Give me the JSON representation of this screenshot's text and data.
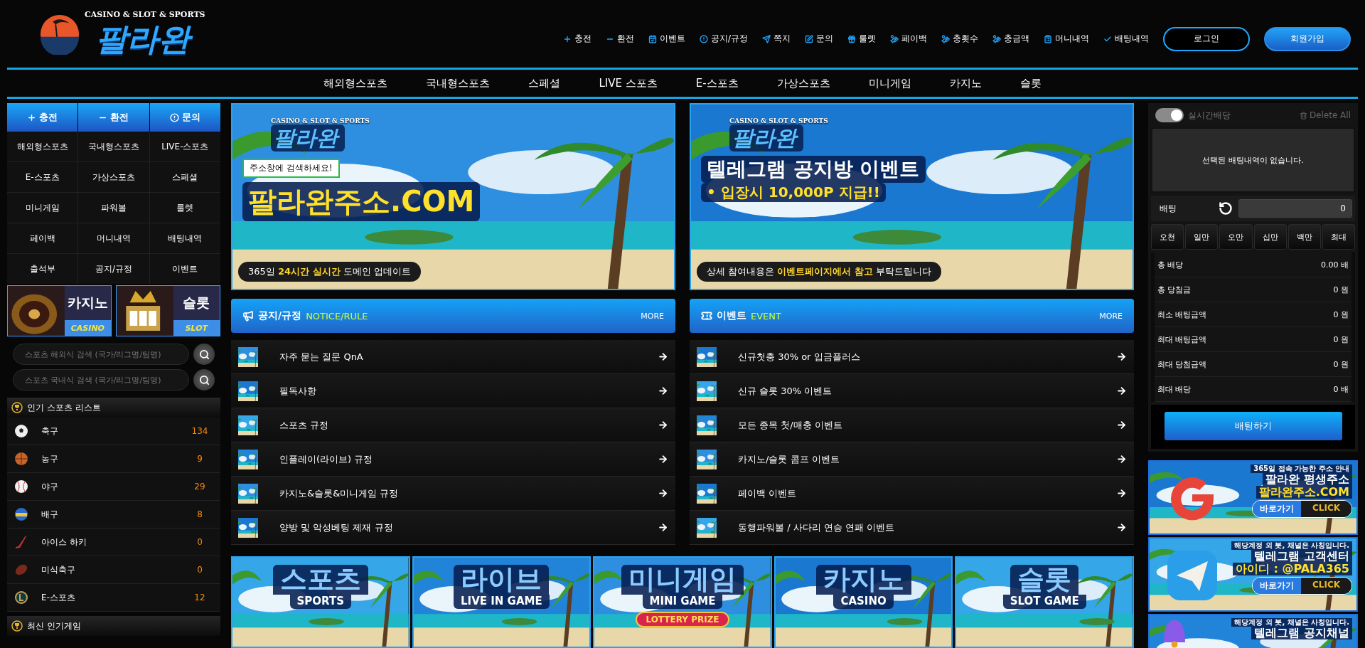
{
  "header": {
    "logo": {
      "tagline": "CASINO & SLOT & SPORTS",
      "name": "팔라완"
    },
    "menu": [
      {
        "label": "충전",
        "kind": "plus"
      },
      {
        "label": "환전",
        "kind": "minus"
      },
      {
        "label": "이벤트",
        "kind": "calendar"
      },
      {
        "label": "공지/규정",
        "kind": "alert"
      },
      {
        "label": "쪽지",
        "kind": "send"
      },
      {
        "label": "문의",
        "kind": "edit"
      },
      {
        "label": "룰렛",
        "kind": "gift"
      },
      {
        "label": "페이백",
        "kind": "hand"
      },
      {
        "label": "충횟수",
        "kind": "hand"
      },
      {
        "label": "충금액",
        "kind": "hand"
      },
      {
        "label": "머니내역",
        "kind": "clipboard"
      },
      {
        "label": "배팅내역",
        "kind": "check"
      }
    ],
    "buttons": [
      {
        "label": "로그인",
        "kind": "outline"
      },
      {
        "label": "회원가입",
        "kind": "filled"
      }
    ]
  },
  "nav": [
    "해외형스포츠",
    "국내형스포츠",
    "스페셜",
    "LIVE 스포츠",
    "E-스포츠",
    "가상스포츠",
    "미니게임",
    "카지노",
    "슬롯"
  ],
  "sidebar": {
    "actions": [
      {
        "label": "충전",
        "kind": "plus"
      },
      {
        "label": "환전",
        "kind": "minus"
      },
      {
        "label": "문의",
        "kind": "alert"
      }
    ],
    "links": [
      "해외형스포츠",
      "국내형스포츠",
      "LIVE-스포츠",
      "E-스포츠",
      "가상스포츠",
      "스페셜",
      "미니게임",
      "파워볼",
      "룰렛",
      "페이백",
      "머니내역",
      "배팅내역",
      "출석부",
      "공지/규정",
      "이벤트"
    ],
    "game_cards": [
      {
        "title": "카지노",
        "subtitle": "CASINO",
        "kind": "casino"
      },
      {
        "title": "슬롯",
        "subtitle": "SLOT",
        "kind": "slot"
      }
    ],
    "searches": [
      {
        "placeholder": "스포츠 해외식 검색 (국가/리그명/팀명)"
      },
      {
        "placeholder": "스포츠 국내식 검색 (국가/리그명/팀명)"
      }
    ],
    "popular": {
      "title": "인기 스포츠 리스트",
      "items": [
        {
          "name": "축구",
          "count": "134",
          "kind": "soccer"
        },
        {
          "name": "농구",
          "count": "9",
          "kind": "basketball"
        },
        {
          "name": "야구",
          "count": "29",
          "kind": "baseball"
        },
        {
          "name": "배구",
          "count": "8",
          "kind": "volleyball"
        },
        {
          "name": "아이스 하키",
          "count": "0",
          "kind": "hockey"
        },
        {
          "name": "미식축구",
          "count": "0",
          "kind": "football"
        },
        {
          "name": "E-스포츠",
          "count": "12",
          "kind": "esports"
        }
      ]
    },
    "next_title": "최신 인기게임"
  },
  "banners": [
    {
      "tagline": "CASINO & SLOT & SPORTS",
      "logo": "팔라완",
      "lines": [
        "주소창에 검색하세요!",
        "팔라완주소.COM",
        "365일 **24시간 실시간** 도메인 업데이트"
      ],
      "kind": "address"
    },
    {
      "tagline": "CASINO & SLOT & SPORTS",
      "logo": "팔라완",
      "lines": [
        "텔레그램 공지방 이벤트",
        "• 입장시 10,000P 지급!!",
        "상세 참여내용은 **이벤트페이지에서 참고** 부탁드립니다"
      ],
      "kind": "telegram"
    }
  ],
  "boards": [
    {
      "title": "공지/규정",
      "subtitle": "NOTICE/RULE",
      "more": "MORE",
      "kind": "megaphone",
      "items": [
        "자주 묻는 질문 QnA",
        "필독사항",
        "스포츠 규정",
        "인플레이(라이브) 규정",
        "카지노&슬롯&미니게임 규정",
        "양방 및 악성베팅 제재 규정"
      ]
    },
    {
      "title": "이벤트",
      "subtitle": "EVENT",
      "more": "MORE",
      "kind": "ticket",
      "items": [
        "신규첫충 30% or 입금플러스",
        "신규 슬롯 30% 이벤트",
        "모든 종목 첫/매충 이벤트",
        "카지노/슬롯 콤프 이벤트",
        "페이백 이벤트",
        "동행파워볼 / 사다리 연승 연패 이벤트"
      ]
    }
  ],
  "tiles": [
    {
      "title": "스포츠",
      "subtitle": "SPORTS"
    },
    {
      "title": "라이브",
      "subtitle": "LIVE IN GAME"
    },
    {
      "title": "미니게임",
      "subtitle": "MINI GAME",
      "badge": "LOTTERY PRIZE"
    },
    {
      "title": "카지노",
      "subtitle": "CASINO"
    },
    {
      "title": "슬롯",
      "subtitle": "SLOT GAME"
    }
  ],
  "betslip": {
    "live_odds": {
      "label": "실시간배당",
      "on": true
    },
    "delete_all": "Delete All",
    "empty_message": "선택된 배팅내역이 없습니다.",
    "bet_label": "배팅",
    "amount": "0",
    "chips": [
      "오천",
      "일만",
      "오만",
      "십만",
      "백만",
      "최대"
    ],
    "stats": [
      {
        "label": "총 배당",
        "value": "0.00 배"
      },
      {
        "label": "총 당첨금",
        "value": "0 원"
      },
      {
        "label": "최소 배팅금액",
        "value": "0 원"
      },
      {
        "label": "최대 배팅금액",
        "value": "0 원"
      },
      {
        "label": "최대 당첨금액",
        "value": "0 원"
      },
      {
        "label": "최대 배당",
        "value": "0 배"
      }
    ],
    "submit": "배팅하기"
  },
  "side_banners": [
    {
      "lines": [
        "365일 접속 가능한 주소 안내",
        "팔라완 평생주소",
        "팔라완주소.COM"
      ],
      "go": "바로가기",
      "click": "CLICK",
      "kind": "google"
    },
    {
      "lines": [
        "해당계정 외 봇, 채널은 사칭입니다.",
        "텔레그램 고객센터",
        "아이디 : @PALA365"
      ],
      "go": "바로가기",
      "click": "CLICK",
      "kind": "telegram"
    },
    {
      "lines": [
        "해당계정 외 봇, 채널은 사칭입니다.",
        "텔레그램 공지채널"
      ],
      "kind": "bell"
    }
  ]
}
